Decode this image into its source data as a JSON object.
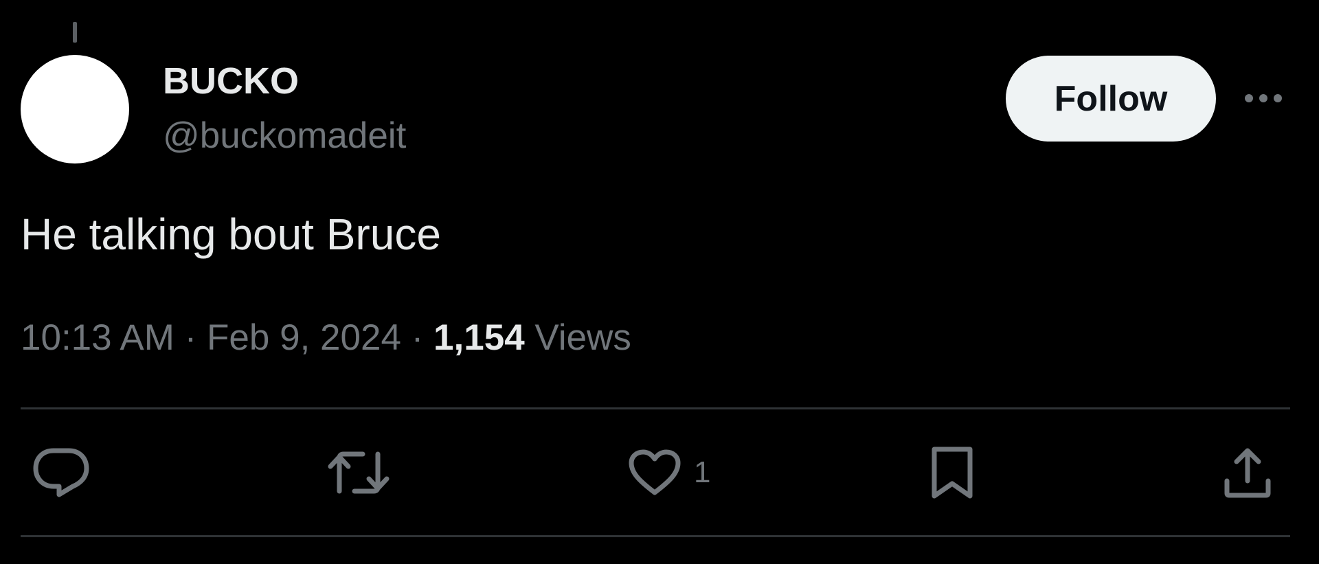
{
  "author": {
    "display_name": "BUCKO",
    "handle": "@buckomadeit"
  },
  "follow_button": {
    "label": "Follow"
  },
  "more_menu": {
    "icon": "more-horizontal-icon"
  },
  "tweet": {
    "text": "He talking bout Bruce",
    "time": "10:13 AM",
    "separator1": " · ",
    "date": "Feb 9, 2024",
    "separator2": " · ",
    "views_count": "1,154",
    "views_label": " Views"
  },
  "actions": {
    "reply": {
      "icon": "reply-icon"
    },
    "retweet": {
      "icon": "retweet-icon"
    },
    "like": {
      "icon": "heart-icon",
      "count": "1"
    },
    "bookmark": {
      "icon": "bookmark-icon"
    },
    "share": {
      "icon": "share-icon"
    }
  },
  "colors": {
    "background": "#000000",
    "primary_text": "#e7e9ea",
    "secondary_text": "#71767b",
    "divider": "#2f3336",
    "follow_bg": "#eff3f4"
  }
}
